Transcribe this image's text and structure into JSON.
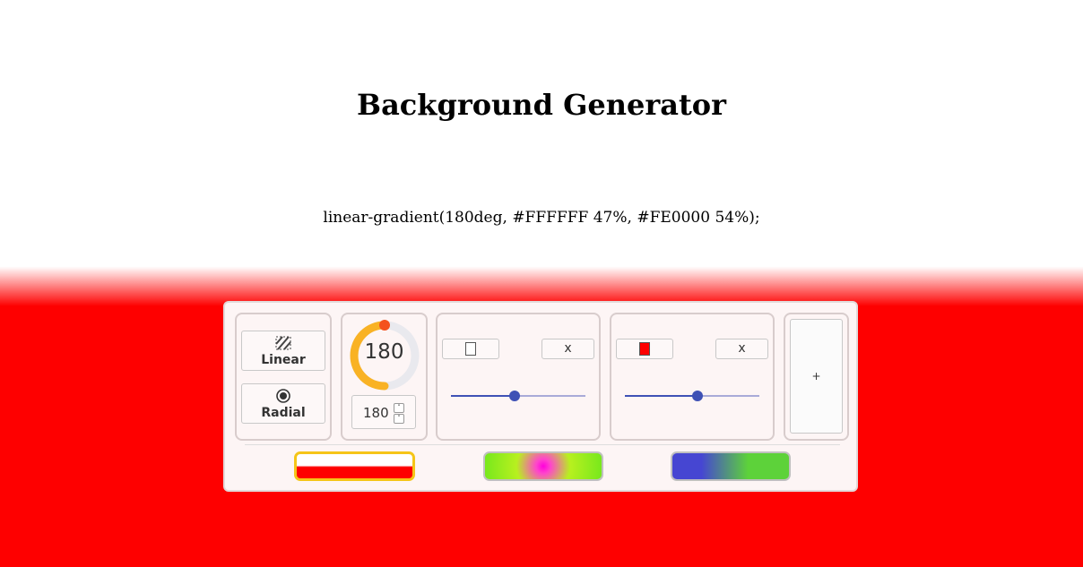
{
  "page": {
    "title": "Background Generator",
    "css_output": "linear-gradient(180deg, #FFFFFF 47%, #FE0000 54%);"
  },
  "gradient_types": [
    {
      "label": "Linear",
      "icon": "stripes-icon",
      "selected": true
    },
    {
      "label": "Radial",
      "icon": "radio-target-icon",
      "selected": false
    }
  ],
  "angle": {
    "dial_value": "180",
    "input_value": "180",
    "progress_fraction": 0.5,
    "track_color": "#e9e9ee",
    "progress_color": "#f9b224",
    "knob_color": "#f4511e"
  },
  "color_stops": [
    {
      "color": "#FFFFFF",
      "position_percent": 47,
      "remove_label": "x"
    },
    {
      "color": "#FE0000",
      "position_percent": 54,
      "remove_label": "x"
    }
  ],
  "add_stop": {
    "label": "+"
  },
  "presets": [
    {
      "name": "white-red",
      "selected": true,
      "border_color": "#f5c518"
    },
    {
      "name": "radial-magenta-green",
      "selected": false,
      "border_color": "#c0c0c0"
    },
    {
      "name": "blue-green",
      "selected": false,
      "border_color": "#c0c0c0"
    }
  ],
  "colors": {
    "slider_accent": "#3f51b5",
    "panel_bg": "#fdf5f5"
  }
}
